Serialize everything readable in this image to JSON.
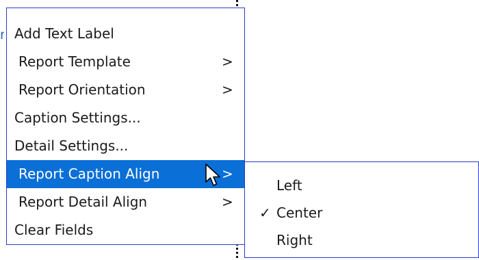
{
  "main_menu": {
    "items": [
      {
        "label": "Add Text Label",
        "arrow": ""
      },
      {
        "label": "Report Template",
        "arrow": ">"
      },
      {
        "label": "Report Orientation",
        "arrow": ">"
      },
      {
        "label": "Caption Settings...",
        "arrow": ""
      },
      {
        "label": "Detail Settings...",
        "arrow": ""
      },
      {
        "label": "Report Caption Align",
        "arrow": ">"
      },
      {
        "label": "Report Detail Align",
        "arrow": ">"
      },
      {
        "label": "Clear Fields",
        "arrow": ""
      }
    ],
    "highlighted_index": 5
  },
  "submenu": {
    "items": [
      {
        "label": "Left",
        "check": ""
      },
      {
        "label": "Center",
        "check": "✓"
      },
      {
        "label": "Right",
        "check": ""
      }
    ],
    "checked": "Center"
  },
  "colors": {
    "highlight": "#0a6fd6",
    "menu_border": "#2b39c9"
  },
  "icons": {
    "cursor": "arrow-cursor-icon",
    "submenu_arrow": "chevron-right-icon",
    "check": "check-icon"
  }
}
